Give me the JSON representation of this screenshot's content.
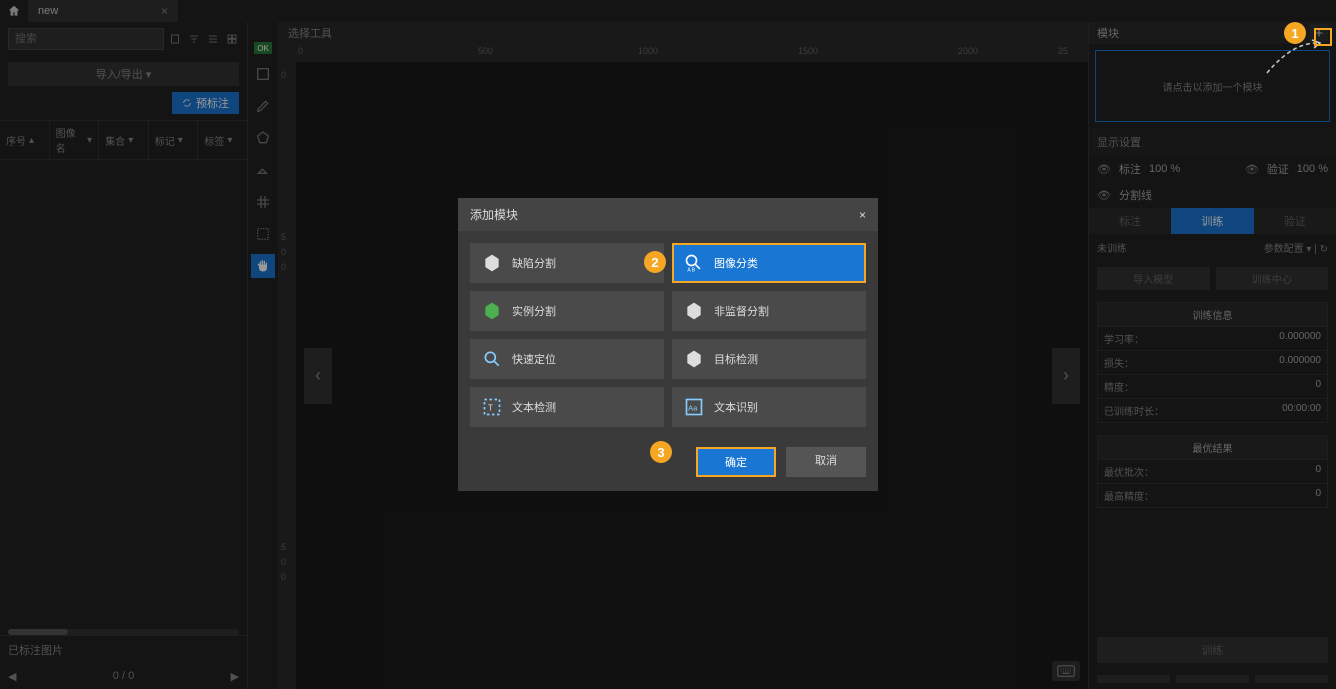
{
  "tab": {
    "name": "new"
  },
  "search": {
    "placeholder": "搜索"
  },
  "import_export": "导入/导出",
  "pre_label": "预标注",
  "filters": [
    "序号",
    "图像名",
    "集合",
    "标记",
    "标签"
  ],
  "labeled_images": "已标注图片",
  "page": {
    "current": "0",
    "sep": "/",
    "total": "0"
  },
  "canvas_header": "选择工具",
  "ruler_h": [
    "0",
    "500",
    "1000",
    "1500",
    "2000",
    "25"
  ],
  "ruler_v": [
    "0",
    "5",
    "0",
    "0",
    "5",
    "0",
    "0"
  ],
  "right": {
    "module_header": "模块",
    "placeholder_text": "请点击以添加一个模块",
    "display_settings": "显示设置",
    "annotation_pct": {
      "label": "标注",
      "value": "100 %"
    },
    "verify_pct": {
      "label": "验证",
      "value": "100 %"
    },
    "segmentation": "分割线",
    "tabs": [
      "标注",
      "训练",
      "验证"
    ],
    "untrained": "未训练",
    "param_config": "参数配置",
    "btn_import": "导入模型",
    "btn_train_center": "训练中心",
    "training_info": "训练信息",
    "rows": [
      {
        "k": "学习率：",
        "v": "0.000000"
      },
      {
        "k": "损失：",
        "v": "0.000000"
      },
      {
        "k": "精度：",
        "v": "0"
      },
      {
        "k": "已训练时长：",
        "v": "00:00:00"
      }
    ],
    "best_result": "最优结果",
    "rows2": [
      {
        "k": "最优批次：",
        "v": "0"
      },
      {
        "k": "最高精度：",
        "v": "0"
      }
    ],
    "train_btn": "训练"
  },
  "dialog": {
    "title": "添加模块",
    "options": [
      "缺陷分割",
      "图像分类",
      "实例分割",
      "非监督分割",
      "快速定位",
      "目标检测",
      "文本检测",
      "文本识别"
    ],
    "ok": "确定",
    "cancel": "取消"
  },
  "steps": {
    "s1": "1",
    "s2": "2",
    "s3": "3"
  }
}
